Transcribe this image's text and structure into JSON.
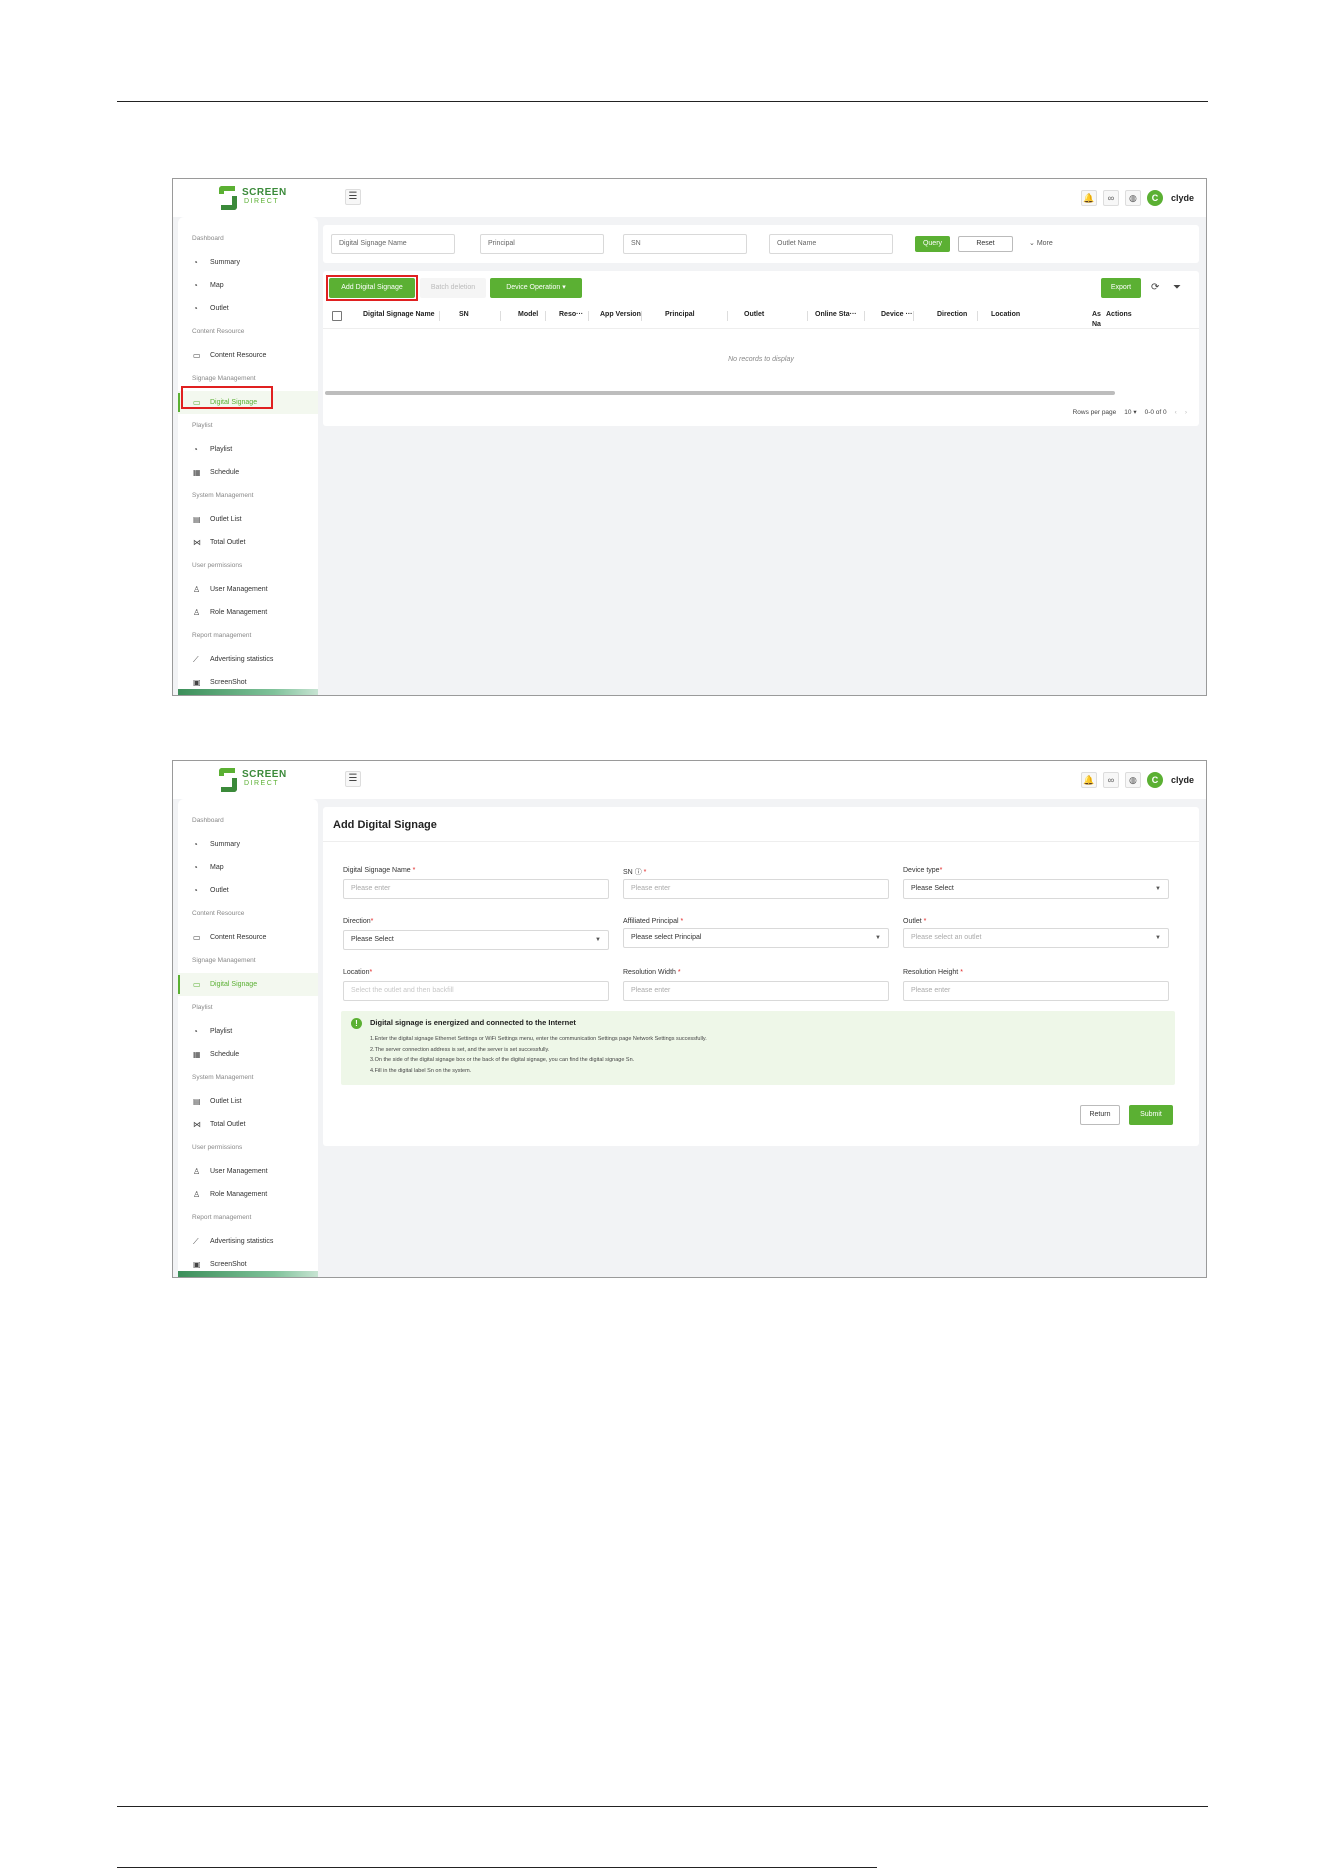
{
  "app": {
    "logo_line1": "SCREEN",
    "logo_line2": "DIRECT",
    "menu_toggle_icon": "menu-fold-icon",
    "user_initial": "C",
    "username": "clyde",
    "accent_color": "#5bb033"
  },
  "sidebar": {
    "groups": {
      "dashboard": "Dashboard",
      "content": "Content Resource",
      "signage": "Signage Management",
      "playlist": "Playlist",
      "system": "System Management",
      "permissions": "User permissions",
      "report": "Report management"
    },
    "items": {
      "summary": "Summary",
      "map": "Map",
      "outlet": "Outlet",
      "content_resource": "Content Resource",
      "digital_signage": "Digital Signage",
      "playlist": "Playlist",
      "schedule": "Schedule",
      "outlet_list": "Outlet List",
      "total_outlet": "Total Outlet",
      "user_management": "User Management",
      "role_management": "Role Management",
      "advertising_statistics": "Advertising statistics",
      "screenshot": "ScreenShot"
    }
  },
  "list_page": {
    "filters": {
      "name_placeholder": "Digital Signage Name",
      "principal_placeholder": "Principal",
      "sn_placeholder": "SN",
      "outlet_placeholder": "Outlet Name",
      "query": "Query",
      "reset": "Reset",
      "more": "More"
    },
    "toolbar": {
      "add": "Add Digital Signage",
      "batch": "Batch deletion",
      "device_operation": "Device Operation",
      "export": "Export"
    },
    "columns": {
      "name": "Digital Signage Name",
      "sn": "SN",
      "model": "Model",
      "resolution": "Reso···",
      "app_version": "App Version",
      "principal": "Principal",
      "outlet": "Outlet",
      "online_status": "Online Sta···",
      "device": "Device ···",
      "direction": "Direction",
      "location": "Location",
      "as_line1": "As",
      "as_line2": "Na",
      "actions": "Actions"
    },
    "empty_text": "No records to display",
    "pagination": {
      "rows_per_page_label": "Rows per page",
      "rows_per_page_value": "10",
      "range": "0-0 of 0"
    }
  },
  "form_page": {
    "title": "Add Digital Signage",
    "fields": {
      "name_label": "Digital Signage Name",
      "name_placeholder": "Please enter",
      "sn_label": "SN",
      "sn_placeholder": "Please enter",
      "device_type_label": "Device type",
      "device_type_value": "Please Select",
      "direction_label": "Direction",
      "direction_value": "Please Select",
      "principal_label": "Affiliated Principal",
      "principal_value": "Please select Principal",
      "outlet_label": "Outlet",
      "outlet_placeholder": "Please select an outlet",
      "location_label": "Location",
      "location_placeholder": "Select the outlet and then backfill",
      "res_width_label": "Resolution Width",
      "res_width_placeholder": "Please enter",
      "res_height_label": "Resolution Height",
      "res_height_placeholder": "Please enter"
    },
    "required_mark": "*",
    "info": {
      "title": "Digital signage is energized and connected to the Internet",
      "line1": "1.Enter the digital signage Ethernet Settings or WiFi Settings menu, enter the communication Settings page Network Settings successfully.",
      "line2": "2.The server connection address is set, and the server is set successfully.",
      "line3": "3.On the side of the digital signage box or the back of the digital signage, you can find the digital signage Sn.",
      "line4": "4.Fill in the digital label Sn on the system."
    },
    "buttons": {
      "return": "Return",
      "submit": "Submit"
    }
  }
}
